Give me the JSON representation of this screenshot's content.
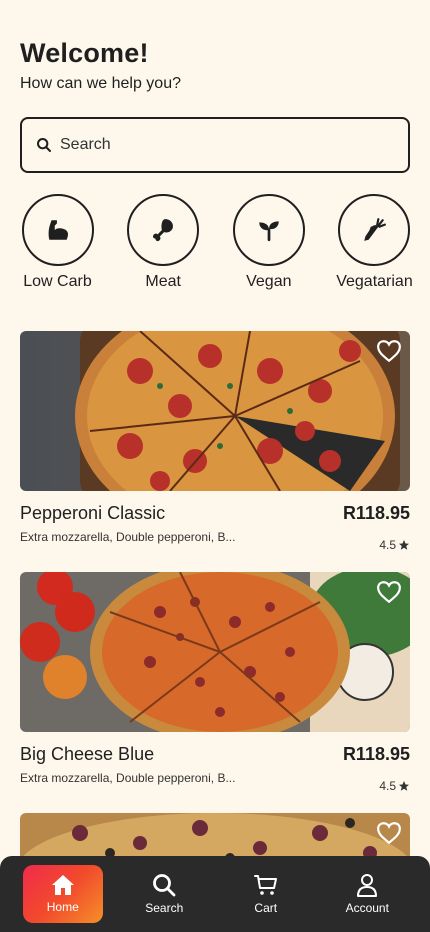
{
  "header": {
    "title": "Welcome!",
    "subtitle": "How can we help you?"
  },
  "search": {
    "placeholder": "Search"
  },
  "categories": [
    {
      "label": "Low Carb",
      "icon": "bicep-icon"
    },
    {
      "label": "Meat",
      "icon": "drumstick-icon"
    },
    {
      "label": "Vegan",
      "icon": "sprout-icon"
    },
    {
      "label": "Vegatarian",
      "icon": "carrot-icon"
    }
  ],
  "products": [
    {
      "name": "Pepperoni Classic",
      "price": "R118.95",
      "description": "Extra mozzarella, Double pepperoni, B...",
      "rating": "4.5"
    },
    {
      "name": "Big Cheese Blue",
      "price": "R118.95",
      "description": "Extra mozzarella, Double pepperoni, B...",
      "rating": "4.5"
    }
  ],
  "nav": {
    "home": "Home",
    "search": "Search",
    "cart": "Cart",
    "account": "Account"
  },
  "colors": {
    "background": "#fdf7ec",
    "text": "#1f1f1f",
    "navbar": "#2a2a2a",
    "accent_start": "#ef2b4b",
    "accent_end": "#f68f2a"
  }
}
